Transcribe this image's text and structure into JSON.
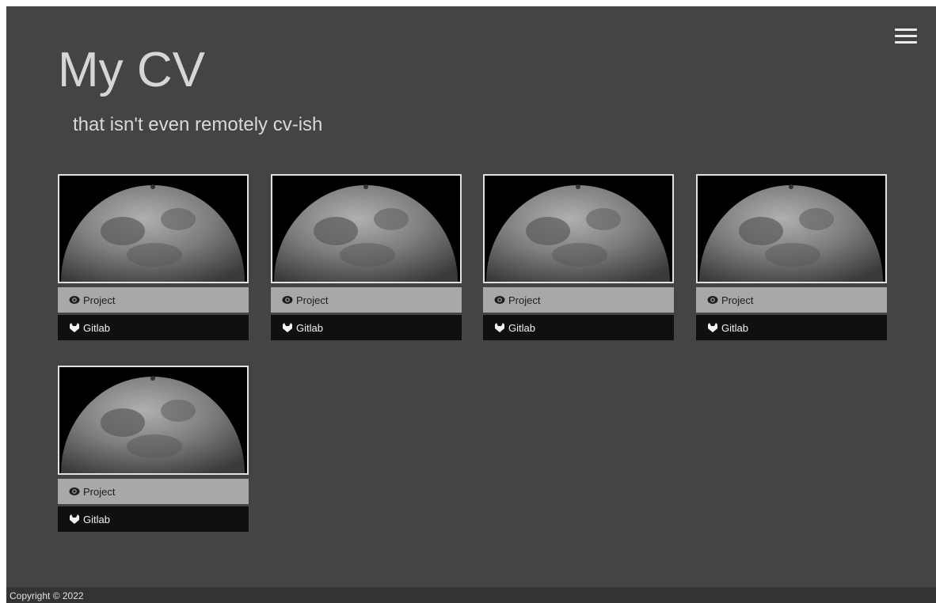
{
  "header": {
    "title": "My CV",
    "subtitle": "that isn't even remotely cv-ish",
    "menu_icon": "hamburger-menu-icon"
  },
  "projects": [
    {
      "project_label": "Project",
      "gitlab_label": "Gitlab",
      "image": "moon-photo"
    },
    {
      "project_label": "Project",
      "gitlab_label": "Gitlab",
      "image": "moon-photo"
    },
    {
      "project_label": "Project",
      "gitlab_label": "Gitlab",
      "image": "moon-photo"
    },
    {
      "project_label": "Project",
      "gitlab_label": "Gitlab",
      "image": "moon-photo"
    },
    {
      "project_label": "Project",
      "gitlab_label": "Gitlab",
      "image": "moon-photo"
    }
  ],
  "icons": {
    "project": "eye-icon",
    "gitlab": "gitlab-fox-icon"
  },
  "footer": {
    "copyright": "Copyright © 2022"
  },
  "colors": {
    "background": "#444444",
    "project_button": "#a8a8a8",
    "gitlab_button": "#101010",
    "footer": "#333333"
  }
}
